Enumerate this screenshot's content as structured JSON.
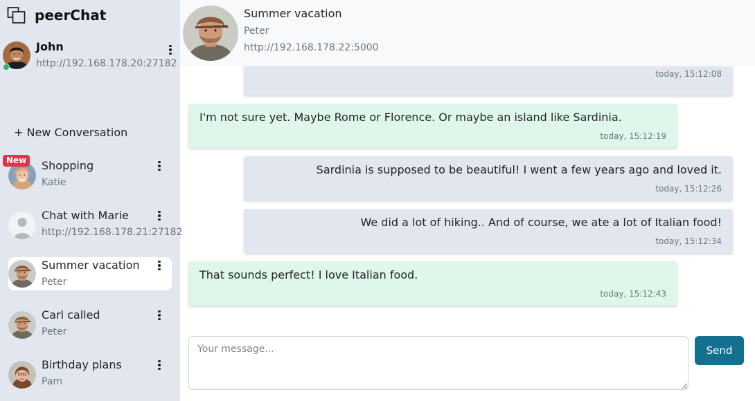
{
  "app": {
    "name": "peerChat"
  },
  "me": {
    "name": "John",
    "url": "http://192.168.178.20:27182",
    "status": "online"
  },
  "sidebar": {
    "new_conversation_label": "+ New Conversation",
    "conversations": [
      {
        "title": "Shopping",
        "subtitle": "Katie",
        "badge": "New",
        "active": false,
        "avatar": "katie-avatar"
      },
      {
        "title": "Chat with Marie",
        "subtitle": "http://192.168.178.21:27182",
        "active": false,
        "avatar": "default-user-avatar"
      },
      {
        "title": "Summer vacation",
        "subtitle": "Peter",
        "active": true,
        "avatar": "peter-avatar"
      },
      {
        "title": "Carl called",
        "subtitle": "Peter",
        "active": false,
        "avatar": "peter-avatar"
      },
      {
        "title": "Birthday plans",
        "subtitle": "Pam",
        "active": false,
        "avatar": "pam-avatar"
      }
    ]
  },
  "header": {
    "title": "Summer vacation",
    "subtitle": "Peter",
    "url": "http://192.168.178.22:5000"
  },
  "messages": [
    {
      "direction": "outgoing",
      "text": "",
      "time": "today, 15:12:08"
    },
    {
      "direction": "incoming",
      "text": "I'm not sure yet. Maybe Rome or Florence. Or maybe an island like Sardinia.",
      "time": "today, 15:12:19"
    },
    {
      "direction": "outgoing",
      "text": "Sardinia is supposed to be beautiful! I went a few years ago and loved it.",
      "time": "today, 15:12:26"
    },
    {
      "direction": "outgoing",
      "text": "We did a lot of hiking.. And of course, we ate a lot of Italian food!",
      "time": "today, 15:12:34"
    },
    {
      "direction": "incoming",
      "text": "That sounds perfect! I love Italian food.",
      "time": "today, 15:12:43"
    }
  ],
  "composer": {
    "placeholder": "Your message...",
    "value": "",
    "send_label": "Send"
  },
  "colors": {
    "sidebar_bg": "#e2e7ef",
    "outgoing_bg": "#e2e7ef",
    "incoming_bg": "#dff6ea",
    "send_button": "#13708f",
    "new_badge": "#dc3545",
    "online": "#2ab572"
  }
}
